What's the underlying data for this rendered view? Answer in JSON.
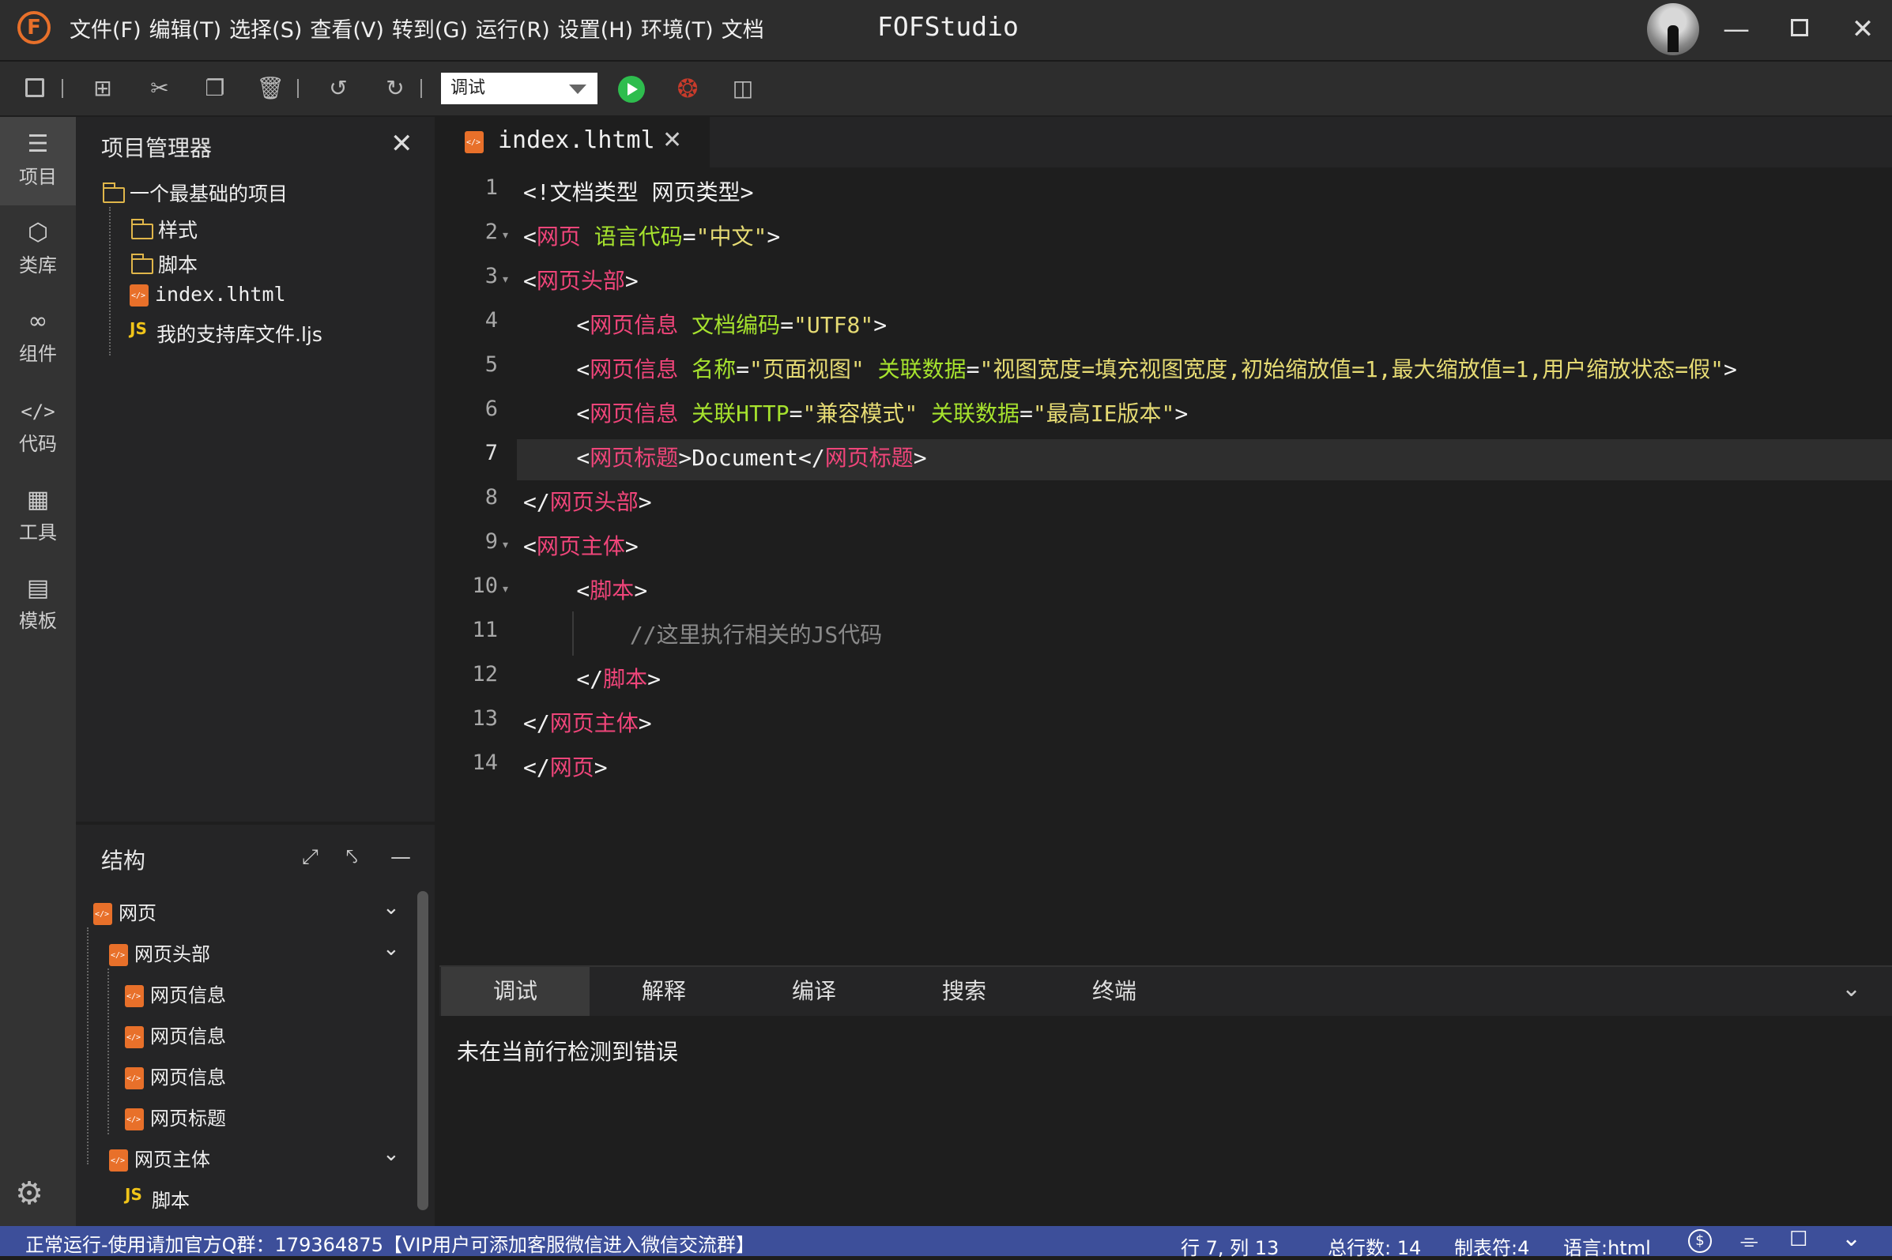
{
  "titlebar": {
    "logo_letter": "F",
    "menus": [
      "文件(F)",
      "编辑(T)",
      "选择(S)",
      "查看(V)",
      "转到(G)",
      "运行(R)",
      "设置(H)",
      "环境(T)",
      "文档"
    ],
    "app_title": "FOFStudio"
  },
  "toolbar": {
    "run_config": "调试",
    "icons": [
      "save-icon",
      "add-icon",
      "cut-icon",
      "paste-icon",
      "delete-icon",
      "undo-icon",
      "redo-icon",
      "run-icon",
      "debug-icon",
      "preview-icon"
    ]
  },
  "activity": {
    "items": [
      {
        "label": "项目",
        "icon": "layers-icon"
      },
      {
        "label": "类库",
        "icon": "cube-icon"
      },
      {
        "label": "组件",
        "icon": "link-icon"
      },
      {
        "label": "代码",
        "icon": "code-icon"
      },
      {
        "label": "工具",
        "icon": "tools-icon"
      },
      {
        "label": "模板",
        "icon": "template-icon"
      }
    ]
  },
  "explorer": {
    "title": "项目管理器",
    "project": "一个最基础的项目",
    "items": [
      {
        "label": "样式",
        "type": "folder"
      },
      {
        "label": "脚本",
        "type": "folder"
      },
      {
        "label": "index.lhtml",
        "type": "html"
      },
      {
        "label": "我的支持库文件.ljs",
        "type": "js"
      }
    ]
  },
  "structure": {
    "title": "结构",
    "nodes": [
      {
        "label": "网页"
      },
      {
        "label": "网页头部"
      },
      {
        "label": "网页信息"
      },
      {
        "label": "网页信息"
      },
      {
        "label": "网页信息"
      },
      {
        "label": "网页标题"
      },
      {
        "label": "网页主体"
      },
      {
        "label": "脚本"
      }
    ]
  },
  "editor": {
    "tab": "index.lhtml",
    "line_numbers": [
      "1",
      "2",
      "3",
      "4",
      "5",
      "6",
      "7",
      "8",
      "9",
      "10",
      "11",
      "12",
      "13",
      "14"
    ],
    "lines": [
      [
        {
          "t": "p",
          "v": "<!文档类型 网页类型>"
        }
      ],
      [
        {
          "t": "p",
          "v": "<"
        },
        {
          "t": "tag",
          "v": "网页"
        },
        {
          "t": "p",
          "v": " "
        },
        {
          "t": "attr",
          "v": "语言代码"
        },
        {
          "t": "p",
          "v": "="
        },
        {
          "t": "str",
          "v": "\"中文\""
        },
        {
          "t": "p",
          "v": ">"
        }
      ],
      [
        {
          "t": "p",
          "v": "<"
        },
        {
          "t": "tag",
          "v": "网页头部"
        },
        {
          "t": "p",
          "v": ">"
        }
      ],
      [
        {
          "t": "p",
          "v": "    <"
        },
        {
          "t": "tag",
          "v": "网页信息"
        },
        {
          "t": "p",
          "v": " "
        },
        {
          "t": "attr",
          "v": "文档编码"
        },
        {
          "t": "p",
          "v": "="
        },
        {
          "t": "str",
          "v": "\"UTF8\""
        },
        {
          "t": "p",
          "v": ">"
        }
      ],
      [
        {
          "t": "p",
          "v": "    <"
        },
        {
          "t": "tag",
          "v": "网页信息"
        },
        {
          "t": "p",
          "v": " "
        },
        {
          "t": "attr",
          "v": "名称"
        },
        {
          "t": "p",
          "v": "="
        },
        {
          "t": "str",
          "v": "\"页面视图\""
        },
        {
          "t": "p",
          "v": " "
        },
        {
          "t": "attr",
          "v": "关联数据"
        },
        {
          "t": "p",
          "v": "="
        },
        {
          "t": "str",
          "v": "\"视图宽度=填充视图宽度,初始缩放值=1,最大缩放值=1,用户缩放状态=假\""
        },
        {
          "t": "p",
          "v": ">"
        }
      ],
      [
        {
          "t": "p",
          "v": "    <"
        },
        {
          "t": "tag",
          "v": "网页信息"
        },
        {
          "t": "p",
          "v": " "
        },
        {
          "t": "attr",
          "v": "关联HTTP"
        },
        {
          "t": "p",
          "v": "="
        },
        {
          "t": "str",
          "v": "\"兼容模式\""
        },
        {
          "t": "p",
          "v": " "
        },
        {
          "t": "attr",
          "v": "关联数据"
        },
        {
          "t": "p",
          "v": "="
        },
        {
          "t": "str",
          "v": "\"最高IE版本\""
        },
        {
          "t": "p",
          "v": ">"
        }
      ],
      [
        {
          "t": "p",
          "v": "    <"
        },
        {
          "t": "tag",
          "v": "网页标题"
        },
        {
          "t": "p",
          "v": ">"
        },
        {
          "t": "txt",
          "v": "Document"
        },
        {
          "t": "p",
          "v": "</"
        },
        {
          "t": "tag",
          "v": "网页标题"
        },
        {
          "t": "p",
          "v": ">"
        }
      ],
      [
        {
          "t": "p",
          "v": "</"
        },
        {
          "t": "tag",
          "v": "网页头部"
        },
        {
          "t": "p",
          "v": ">"
        }
      ],
      [
        {
          "t": "p",
          "v": "<"
        },
        {
          "t": "tag",
          "v": "网页主体"
        },
        {
          "t": "p",
          "v": ">"
        }
      ],
      [
        {
          "t": "p",
          "v": "    <"
        },
        {
          "t": "tag",
          "v": "脚本"
        },
        {
          "t": "p",
          "v": ">"
        }
      ],
      [
        {
          "t": "cm",
          "v": "        //这里执行相关的JS代码"
        }
      ],
      [
        {
          "t": "p",
          "v": "    </"
        },
        {
          "t": "tag",
          "v": "脚本"
        },
        {
          "t": "p",
          "v": ">"
        }
      ],
      [
        {
          "t": "p",
          "v": "</"
        },
        {
          "t": "tag",
          "v": "网页主体"
        },
        {
          "t": "p",
          "v": ">"
        }
      ],
      [
        {
          "t": "p",
          "v": "</"
        },
        {
          "t": "tag",
          "v": "网页"
        },
        {
          "t": "p",
          "v": ">"
        }
      ]
    ]
  },
  "panel": {
    "tabs": [
      "调试",
      "解释",
      "编译",
      "搜索",
      "终端"
    ],
    "message": "未在当前行检测到错误"
  },
  "status": {
    "left": "正常运行-使用请加官方Q群：179364875【VIP用户可添加客服微信进入微信交流群】",
    "position": "行 7, 列 13",
    "total_lines": "总行数: 14",
    "tab_size": "制表符:4",
    "language": "语言:html"
  },
  "colors": {
    "accent": "#e8702a",
    "status_bar": "#3d4f9a",
    "tag": "#f0457a",
    "attr": "#a6e22e",
    "string": "#e6db74"
  }
}
